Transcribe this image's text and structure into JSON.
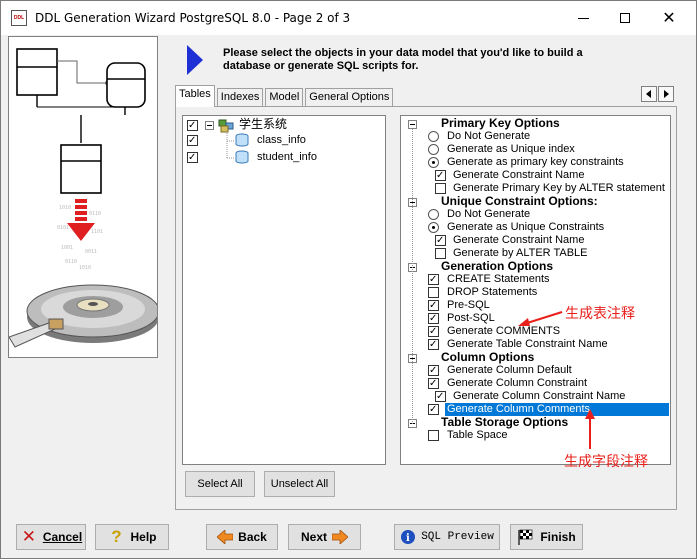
{
  "window": {
    "title": "DDL Generation Wizard PostgreSQL 8.0 - Page 2 of 3",
    "icon_text": "DDL"
  },
  "header": {
    "instruction": "Please select the objects in your data model that you'd like to build a database or generate SQL scripts for."
  },
  "tabs": [
    {
      "label": "Tables",
      "active": true
    },
    {
      "label": "Indexes",
      "active": false
    },
    {
      "label": "Model",
      "active": false
    },
    {
      "label": "General Options",
      "active": false
    }
  ],
  "tables_tree": {
    "root": {
      "label": "学生系统",
      "checked": true
    },
    "children": [
      {
        "label": "class_info",
        "checked": true
      },
      {
        "label": "student_info",
        "checked": true
      }
    ]
  },
  "options": {
    "pk": {
      "title": "Primary Key Options",
      "items": [
        {
          "label": "Do Not Generate",
          "selected": false
        },
        {
          "label": "Generate as Unique index",
          "selected": false
        },
        {
          "label": "Generate as primary key constraints",
          "selected": true
        }
      ],
      "sub": [
        {
          "label": "Generate Constraint Name",
          "checked": true
        },
        {
          "label": "Generate Primary Key by ALTER statement",
          "checked": false
        }
      ]
    },
    "uc": {
      "title": "Unique Constraint Options:",
      "items": [
        {
          "label": "Do Not Generate",
          "selected": false
        },
        {
          "label": "Generate as Unique Constraints",
          "selected": true
        }
      ],
      "sub": [
        {
          "label": "Generate Constraint Name",
          "checked": true
        },
        {
          "label": "Generate by ALTER TABLE",
          "checked": false
        }
      ]
    },
    "gen": {
      "title": "Generation Options",
      "items": [
        {
          "label": "CREATE Statements",
          "checked": true
        },
        {
          "label": "DROP Statements",
          "checked": false
        },
        {
          "label": "Pre-SQL",
          "checked": true
        },
        {
          "label": "Post-SQL",
          "checked": true
        },
        {
          "label": "Generate COMMENTS",
          "checked": true
        },
        {
          "label": "Generate Table Constraint Name",
          "checked": true
        }
      ]
    },
    "col": {
      "title": "Column Options",
      "items": [
        {
          "label": "Generate Column Default",
          "checked": true
        },
        {
          "label": "Generate Column Constraint",
          "checked": true
        }
      ],
      "sub": {
        "label": "Generate Column Constraint Name",
        "checked": true
      },
      "comments": {
        "label": "Generate Column Comments",
        "checked": true
      }
    },
    "ts": {
      "title": "Table Storage Options",
      "items": [
        {
          "label": "Table Space",
          "checked": false
        }
      ]
    }
  },
  "annotations": {
    "table_comment": "生成表注释",
    "column_comment": "生成字段注释"
  },
  "buttons": {
    "select_all": "Select All",
    "unselect_all": "Unselect All",
    "cancel": "Cancel",
    "help": "Help",
    "back": "Back",
    "next": "Next",
    "sql_preview": "SQL Preview",
    "finish": "Finish"
  },
  "colors": {
    "selection": "#0078d7",
    "annotation": "#e8201b",
    "arrow_blue": "#1f2fd6"
  }
}
